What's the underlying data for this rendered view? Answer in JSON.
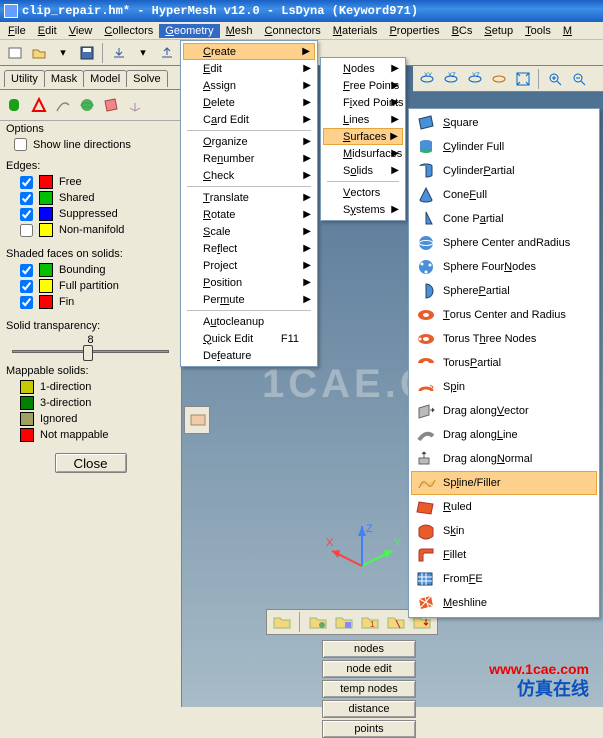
{
  "title": "clip_repair.hm* - HyperMesh v12.0 - LsDyna (Keyword971)",
  "menubar": [
    "File",
    "Edit",
    "View",
    "Collectors",
    "Geometry",
    "Mesh",
    "Connectors",
    "Materials",
    "Properties",
    "BCs",
    "Setup",
    "Tools",
    "M"
  ],
  "menubar_hot_index": 4,
  "tabs": [
    "Utility",
    "Mask",
    "Model",
    "Solve"
  ],
  "left": {
    "options_title": "Options",
    "show_line_dirs": "Show line directions",
    "edges_title": "Edges:",
    "edges": [
      {
        "label": "Free",
        "color": "#ff0000",
        "checked": true
      },
      {
        "label": "Shared",
        "color": "#00c000",
        "checked": true
      },
      {
        "label": "Suppressed",
        "color": "#0000ff",
        "checked": true
      },
      {
        "label": "Non-manifold",
        "color": "#ffff00",
        "checked": false
      }
    ],
    "shaded_title": "Shaded faces on solids:",
    "shaded": [
      {
        "label": "Bounding",
        "color": "#00c000",
        "checked": true
      },
      {
        "label": "Full partition",
        "color": "#ffff00",
        "checked": true
      },
      {
        "label": "Fin",
        "color": "#ff0000",
        "checked": true
      }
    ],
    "transparency_title": "Solid transparency:",
    "transparency_value": "8",
    "mappable_title": "Mappable solids:",
    "mappable": [
      {
        "label": "1-direction",
        "color": "#c8c800"
      },
      {
        "label": "3-direction",
        "color": "#008000"
      },
      {
        "label": "Ignored",
        "color": "#a0a060"
      },
      {
        "label": "Not mappable",
        "color": "#ff0000"
      }
    ],
    "close_label": "Close"
  },
  "geometry_menu": [
    {
      "label": "Create",
      "u": 0,
      "arrow": true,
      "hov": true
    },
    {
      "label": "Edit",
      "u": 0,
      "arrow": true
    },
    {
      "label": "Assign",
      "u": 0,
      "arrow": true
    },
    {
      "label": "Delete",
      "u": 0,
      "arrow": true
    },
    {
      "label": "Card Edit",
      "u": 1,
      "arrow": true
    },
    {
      "sep": true
    },
    {
      "label": "Organize",
      "u": 0,
      "arrow": true
    },
    {
      "label": "Renumber",
      "u": 2,
      "arrow": true
    },
    {
      "label": "Check",
      "u": 0,
      "arrow": true
    },
    {
      "sep": true
    },
    {
      "label": "Translate",
      "u": 0,
      "arrow": true
    },
    {
      "label": "Rotate",
      "u": 0,
      "arrow": true
    },
    {
      "label": "Scale",
      "u": 0,
      "arrow": true
    },
    {
      "label": "Reflect",
      "u": 2,
      "arrow": true
    },
    {
      "label": "Project",
      "u": 3,
      "arrow": true
    },
    {
      "label": "Position",
      "u": 0,
      "arrow": true
    },
    {
      "label": "Permute",
      "u": 3,
      "arrow": true
    },
    {
      "sep": true
    },
    {
      "label": "Autocleanup",
      "u": 1
    },
    {
      "label": "Quick Edit",
      "u": 0,
      "kbd": "F11"
    },
    {
      "label": "Defeature",
      "u": 2
    }
  ],
  "create_menu": [
    {
      "label": "Nodes",
      "u": 0,
      "arrow": true
    },
    {
      "label": "Free Points",
      "u": 0,
      "arrow": true
    },
    {
      "label": "Fixed Points",
      "u": 1,
      "arrow": true
    },
    {
      "label": "Lines",
      "u": 0,
      "arrow": true
    },
    {
      "label": "Surfaces",
      "u": 0,
      "arrow": true,
      "hov": true
    },
    {
      "label": "Midsurfaces",
      "u": 0,
      "arrow": true
    },
    {
      "label": "Solids",
      "u": 1,
      "arrow": true
    },
    {
      "sep": true
    },
    {
      "label": "Vectors",
      "u": 0
    },
    {
      "label": "Systems",
      "u": 1,
      "arrow": true
    }
  ],
  "surfaces_menu": [
    {
      "label": "Square",
      "u": 0,
      "icon": "square"
    },
    {
      "label": "Cylinder Full",
      "u": 0,
      "icon": "cyl-full"
    },
    {
      "label": "Cylinder Partial",
      "u": 9,
      "icon": "cyl-part"
    },
    {
      "label": "Cone Full",
      "u": 5,
      "icon": "cone-full"
    },
    {
      "label": "Cone Partial",
      "u": 6,
      "icon": "cone-part"
    },
    {
      "label": "Sphere Center and Radius",
      "u": 17,
      "icon": "sph-cr"
    },
    {
      "label": "Sphere Four Nodes",
      "u": 12,
      "icon": "sph-4"
    },
    {
      "label": "Sphere Partial",
      "u": 7,
      "icon": "sph-p"
    },
    {
      "label": "Torus Center and Radius",
      "u": 0,
      "icon": "tor-cr"
    },
    {
      "label": "Torus Three Nodes",
      "u": 7,
      "icon": "tor-3"
    },
    {
      "label": "Torus Partial",
      "u": 6,
      "icon": "tor-p"
    },
    {
      "label": "Spin",
      "u": 1,
      "icon": "spin"
    },
    {
      "label": "Drag along Vector",
      "u": 11,
      "icon": "drag-v"
    },
    {
      "label": "Drag along Line",
      "u": 11,
      "icon": "drag-l"
    },
    {
      "label": "Drag along Normal",
      "u": 11,
      "icon": "drag-n"
    },
    {
      "label": "Spline/Filler",
      "u": 2,
      "icon": "spline",
      "hov": true
    },
    {
      "label": "Ruled",
      "u": 0,
      "icon": "ruled"
    },
    {
      "label": "Skin",
      "u": 1,
      "icon": "skin"
    },
    {
      "label": "Fillet",
      "u": 0,
      "icon": "fillet"
    },
    {
      "label": "From FE",
      "u": 5,
      "icon": "from-fe"
    },
    {
      "label": "Meshline",
      "u": 0,
      "icon": "meshline"
    }
  ],
  "panel_buttons": [
    "nodes",
    "node edit",
    "temp nodes",
    "distance",
    "points"
  ],
  "watermark": "1CAE.COM",
  "axis_labels": {
    "x": "X",
    "y": "Y",
    "z": "Z"
  },
  "footer_url": "www.1cae.com",
  "footer_brand": "仿真在线"
}
